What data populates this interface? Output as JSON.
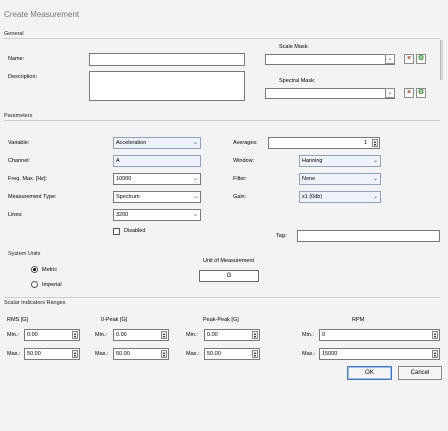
{
  "window": {
    "title": "Create Measurement"
  },
  "general": {
    "header": "General",
    "name_label": "Name:",
    "name_value": "",
    "description_label": "Description:",
    "description_value": "",
    "scale_mask_label": "Scale Mask:",
    "spectral_mask_label": "Spectral Mask:"
  },
  "parameters": {
    "header": "Parameters",
    "variable_label": "Variable:",
    "variable_value": "Acceleration",
    "channel_label": "Channel:",
    "channel_value": "A",
    "freq_max_label": "Freq. Max. [Hz]:",
    "freq_max_value": "10000",
    "measurement_type_label": "Measurement Type:",
    "measurement_type_value": "Spectrum",
    "lines_label": "Lines:",
    "lines_value": "3200",
    "disabled_label": "Disabled",
    "averages_label": "Averages:",
    "averages_value": "1",
    "window_label": "Window:",
    "window_value": "Hanning",
    "filter_label": "Filter:",
    "filter_value": "None",
    "gain_label": "Gain:",
    "gain_value": "x1 (0db)",
    "tag_label": "Tag:",
    "tag_value": ""
  },
  "system_units": {
    "header": "System Units",
    "metric_label": "Metric",
    "imperial_label": "Imperial",
    "unit_header": "Unit of Measurement",
    "unit_value": "G"
  },
  "scalar": {
    "header": "Scalar Indicators Ranges",
    "columns": [
      {
        "title": "RMS [G]",
        "min_label": "Min.:",
        "min": "0.00",
        "max_label": "Max.:",
        "max": "50.00"
      },
      {
        "title": "0-Peak [G]",
        "min_label": "Min.:",
        "min": "0.00",
        "max_label": "Max.:",
        "max": "50.00"
      },
      {
        "title": "Peak-Peak [G]",
        "min_label": "Min.:",
        "min": "0.00",
        "max_label": "Max.:",
        "max": "50.00"
      },
      {
        "title": "RPM",
        "min_label": "Min.:",
        "min": "0",
        "max_label": "Max.:",
        "max": "15000"
      }
    ]
  },
  "buttons": {
    "ok": "OK",
    "cancel": "Cancel"
  }
}
